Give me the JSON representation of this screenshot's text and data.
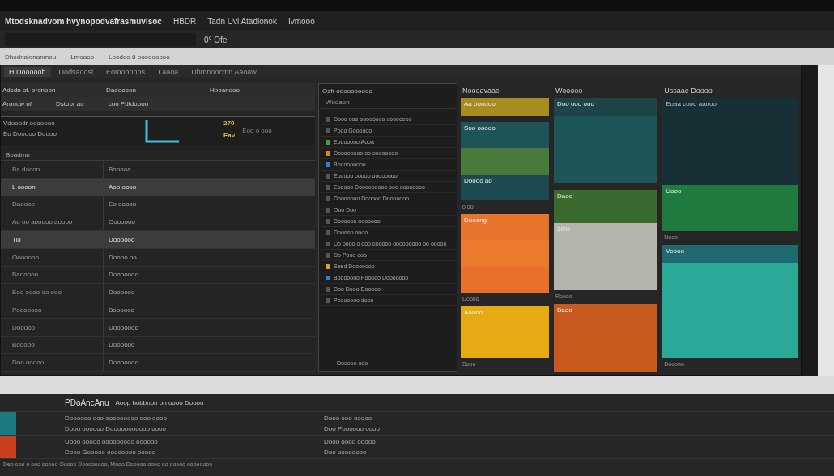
{
  "title_bar": {
    "title": "Mtodsknadvom hvynopodvafrasmuvlsoc",
    "items": [
      "HBDR",
      "Tadn Uvl Atadlonok",
      "Ivmooo"
    ]
  },
  "address_bar": {
    "value": "0° Ofe"
  },
  "browser_bar": {
    "items": [
      "Dhodnalonanmou",
      "Lmoaoo",
      "Loodoo 8 ooooooooo"
    ]
  },
  "tabs": [
    {
      "label": "H Doooooh",
      "selected": true
    },
    {
      "label": "Dodsaoosi",
      "selected": false
    },
    {
      "label": "Eotoooooos",
      "selected": false
    },
    {
      "label": "Laaoa",
      "selected": false
    },
    {
      "label": "Dhmnoocmn Aaoaw",
      "selected": false
    }
  ],
  "left_pane": {
    "columns": [
      "Adsdn ot. ordnoon",
      "Dadoooon",
      "Hpoanooo"
    ],
    "filters": [
      "Arooow nf",
      "Dstoor ao",
      "coo Pdtdoooo"
    ],
    "summary": {
      "label": "Vdooodr ooooooo",
      "sublabel": "Eo Dooooo Doooo",
      "readings": [
        "270",
        "Eav"
      ],
      "note": "Eoo o ooo"
    },
    "group": "Boadmn",
    "rows": [
      {
        "name": "Ba dooon",
        "value": "Boooaa",
        "selected": false
      },
      {
        "name": "L oooon",
        "value": "Aoo oooo",
        "selected": true
      },
      {
        "name": "Daoooo",
        "value": "Eo ooooo",
        "selected": false
      },
      {
        "name": "Ao oo aooooo aoooo",
        "value": "Ooooooo",
        "selected": false
      },
      {
        "name": "Tio",
        "value": "Doooooo",
        "selected": true
      },
      {
        "name": "Ooooooo",
        "value": "Doooo oo",
        "selected": false
      },
      {
        "name": "Baooooo",
        "value": "Dooooooo",
        "selected": false
      },
      {
        "name": "Eoo oooo oo ooo",
        "value": "Doooooo",
        "selected": false
      },
      {
        "name": "Pooooooo",
        "value": "Boooooo",
        "selected": false
      },
      {
        "name": "Dooooo",
        "value": "Dooooooo",
        "selected": false
      },
      {
        "name": "Booooo",
        "value": "Doooooo",
        "selected": false
      },
      {
        "name": "Doo ooooo",
        "value": "Dooooooo",
        "selected": false
      }
    ]
  },
  "middle_pane": {
    "title": "Osfr oooooooooo",
    "subtitle": "Wooaon",
    "items": [
      {
        "label": "Dooo ooo oooooooo oooooooo",
        "color": "#555555"
      },
      {
        "label": "Pooo Goooooo",
        "color": "#555555"
      },
      {
        "label": "Eooooooo Aooa",
        "color": "#3aa040"
      },
      {
        "label": "Doooooooo oo oooooooo",
        "color": "#e08020"
      },
      {
        "label": "Booooooooo",
        "color": "#3080d0"
      },
      {
        "label": "Eooooo ooooo oooooooo",
        "color": "#555555"
      },
      {
        "label": "Eooooo Dooooooooo ooo oooooooo",
        "color": "#555555"
      },
      {
        "label": "Dooooooo Dooooo Dooooooo",
        "color": "#555555"
      },
      {
        "label": "Ooo Doo",
        "color": "#555555"
      },
      {
        "label": "Doooooo ooooooo",
        "color": "#555555"
      },
      {
        "label": "Dooooo oooo",
        "color": "#555555"
      },
      {
        "label": "Do oooo o ooo oooooo ooooooooo oo ooooo",
        "color": "#555555"
      },
      {
        "label": "Do Pooo ooo",
        "color": "#555555"
      },
      {
        "label": "Seed Dooooooo",
        "color": "#e0a020"
      },
      {
        "label": "Booooooo Pooooo Dooooooo",
        "color": "#3080d0"
      },
      {
        "label": "Doo Dooo Dooooo",
        "color": "#555555"
      },
      {
        "label": "Pooooooo dooo",
        "color": "#555555"
      }
    ],
    "footer": "Dooooo ooo"
  },
  "tiles": [
    {
      "title": "Nooodvaac",
      "blocks": [
        {
          "kind": "strip",
          "color": "#a88c20",
          "label": "Aa oooooo"
        },
        {
          "kind": "gap"
        },
        {
          "kind": "panel",
          "color": "#1e5458",
          "label": "Soo ooooo"
        },
        {
          "kind": "panel",
          "color": "#4a7a3a"
        },
        {
          "kind": "panel",
          "color": "#1d4a50",
          "label": "Doooo ao"
        },
        {
          "kind": "caption",
          "label": "o oo"
        },
        {
          "kind": "panel",
          "color": "#e8732a",
          "label": "Dooang"
        },
        {
          "kind": "panel",
          "color": "#ec7a2c"
        },
        {
          "kind": "panel",
          "color": "#e8702a"
        },
        {
          "kind": "caption",
          "label": "Doooo"
        },
        {
          "kind": "tall",
          "color": "#e6aa12",
          "label": "Aoooo"
        },
        {
          "kind": "caption",
          "label": "Sooo"
        }
      ]
    },
    {
      "title": "Wooooo",
      "blocks": [
        {
          "kind": "strip",
          "color": "#1f4448",
          "label": "Doo ooo ooo"
        },
        {
          "kind": "tall",
          "color": "#1e5558"
        },
        {
          "kind": "gap"
        },
        {
          "kind": "panel",
          "color": "#3b6a2e",
          "label": "Daoo"
        },
        {
          "kind": "tall",
          "color": "#b4b6ac",
          "label": "30%"
        },
        {
          "kind": "caption",
          "label": "Roooo"
        },
        {
          "kind": "tall",
          "color": "#c85a20",
          "label": "Baoo"
        }
      ]
    },
    {
      "title": "Ussaae Doooo",
      "blocks": [
        {
          "kind": "card",
          "color": "#173036",
          "label": "Eoaa cooo aaooo"
        },
        {
          "kind": "panel",
          "color": "#1f7a40",
          "label": "Uooo"
        },
        {
          "kind": "caption",
          "label": "Nooo"
        },
        {
          "kind": "strip",
          "color": "#1e6a70",
          "label": "Voooo"
        },
        {
          "kind": "tall",
          "color": "#2aa898"
        },
        {
          "kind": "caption",
          "label": "Dooono"
        }
      ]
    }
  ],
  "bottom_panel": {
    "title": "PDoAncAnu",
    "subtitle": "Aoop hobbnon on oooo Doooo",
    "rows": [
      {
        "color": "#1e7a80",
        "lines": [
          "Doooooo ooo ooooooooo ooo oooo",
          "Dooo oooooo Dooooooooooo oooo"
        ],
        "side": [
          "Dooo ooo ooooo",
          "Doo Poooooo oooo"
        ]
      },
      {
        "color": "#c8401e",
        "lines": [
          "Uooo ooooo ooooooooo oooooo",
          "Dooo Gooooo oooooooo ooooo"
        ],
        "side": [
          "Dooo oooo ooooo",
          "Doo oooooooo"
        ]
      }
    ],
    "status": "Deo ooo o ooo ooooo Ooooo Doooooooo, Mooo Dooooo oooo oo ooooo oooooooo"
  }
}
